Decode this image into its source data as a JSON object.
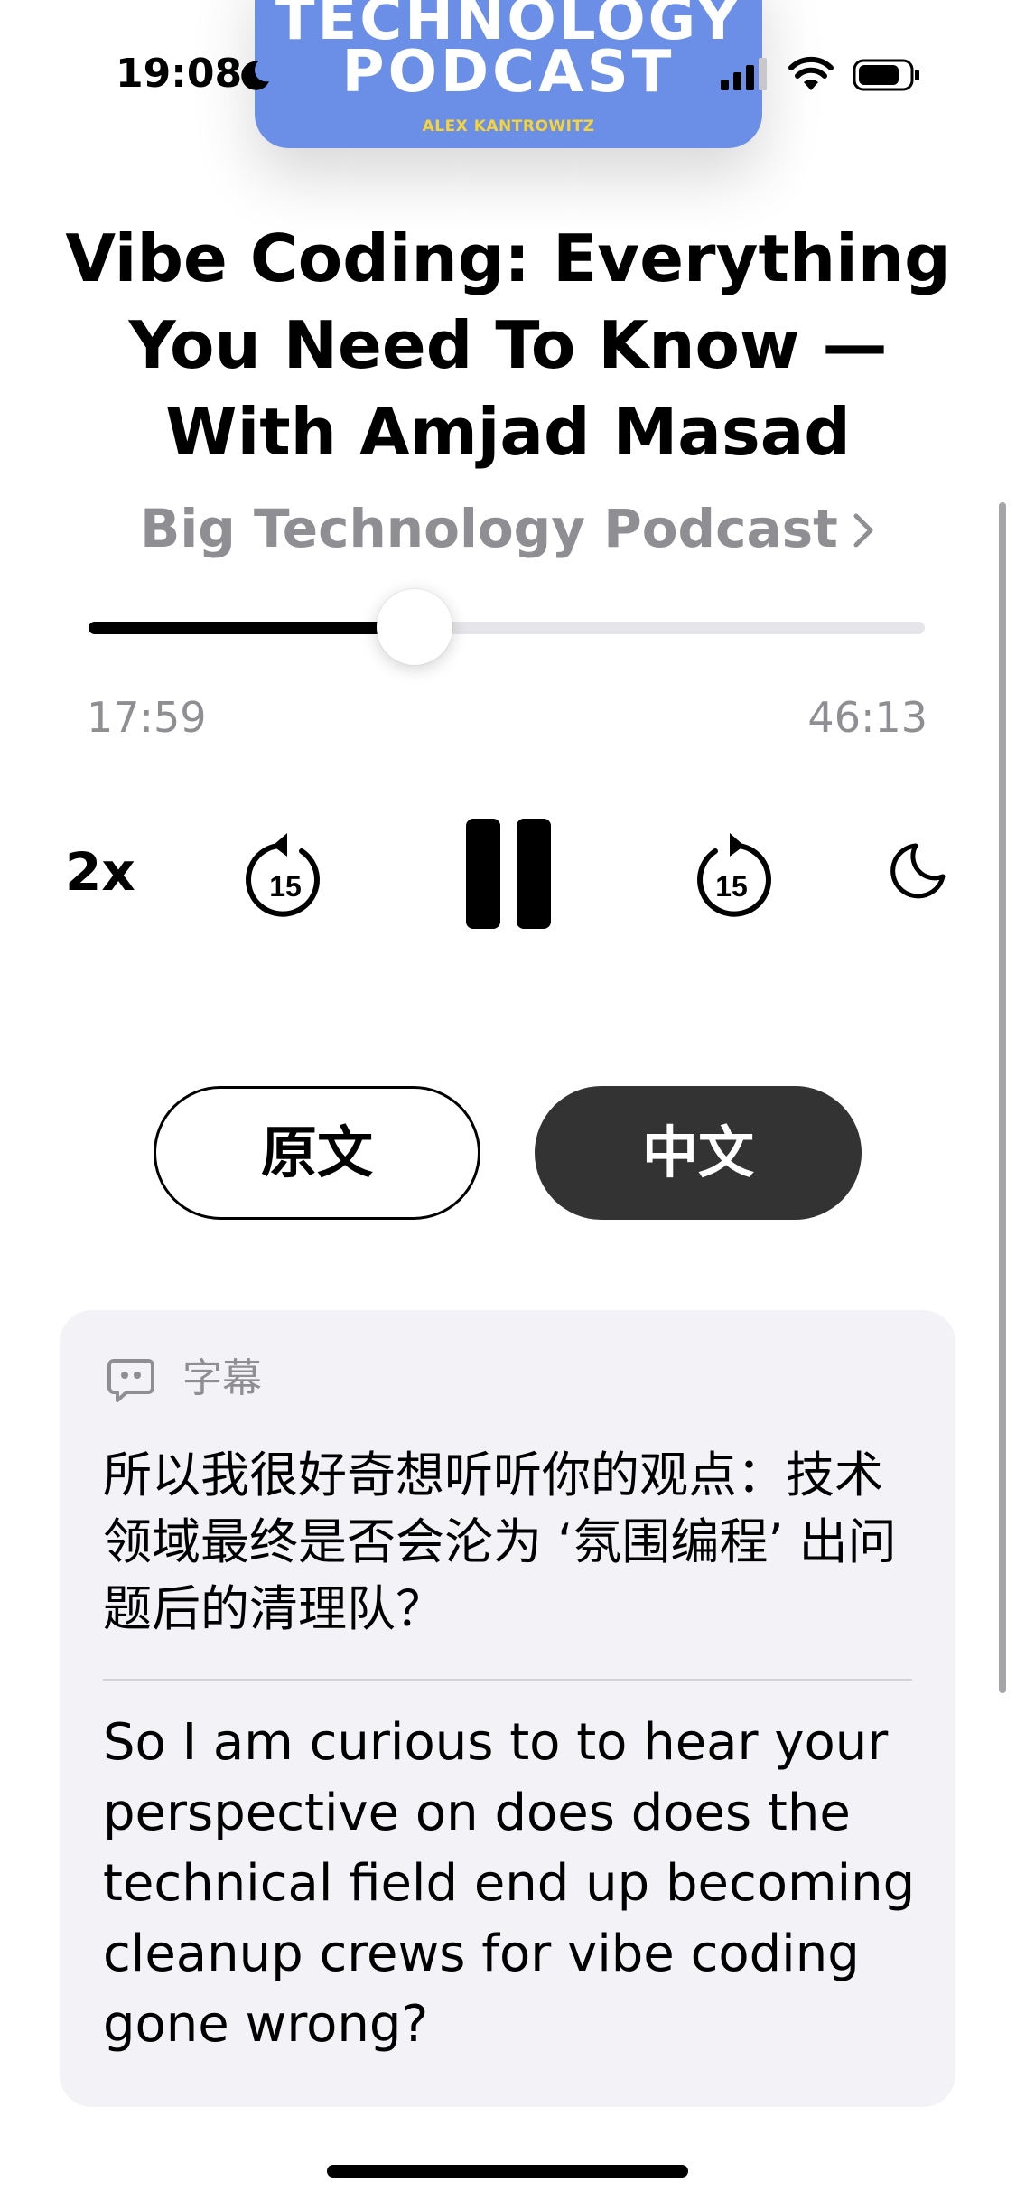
{
  "status_bar": {
    "time": "19:08"
  },
  "artwork": {
    "line1": "TECHNOLOGY",
    "line2": "PODCAST",
    "author": "ALEX KANTROWITZ"
  },
  "episode": {
    "title": "Vibe Coding: Everything You Need To Know — With Amjad Masad",
    "show_name": "Big Technology Podcast"
  },
  "playback": {
    "elapsed": "17:59",
    "remaining": "46:13",
    "progress": 0.39,
    "speed_label": "2x",
    "skip_back_seconds": "15",
    "skip_forward_seconds": "15"
  },
  "language_toggle": {
    "original_label": "原文",
    "chinese_label": "中文",
    "selected": "中文"
  },
  "subtitles": {
    "label": "字幕",
    "chinese_text": "所以我很好奇想听听你的观点：技术领域最终是否会沦为 ‘氛围编程’ 出问题后的清理队？",
    "english_text": "So I am curious to to hear your perspective on does does the technical field end up becoming cleanup crews for vibe coding gone wrong?"
  },
  "colors": {
    "accent_dark": "#333333",
    "secondary_text": "#8e8e93",
    "card_bg": "#f2f2f7",
    "artwork_blue": "#6b8fe6"
  }
}
